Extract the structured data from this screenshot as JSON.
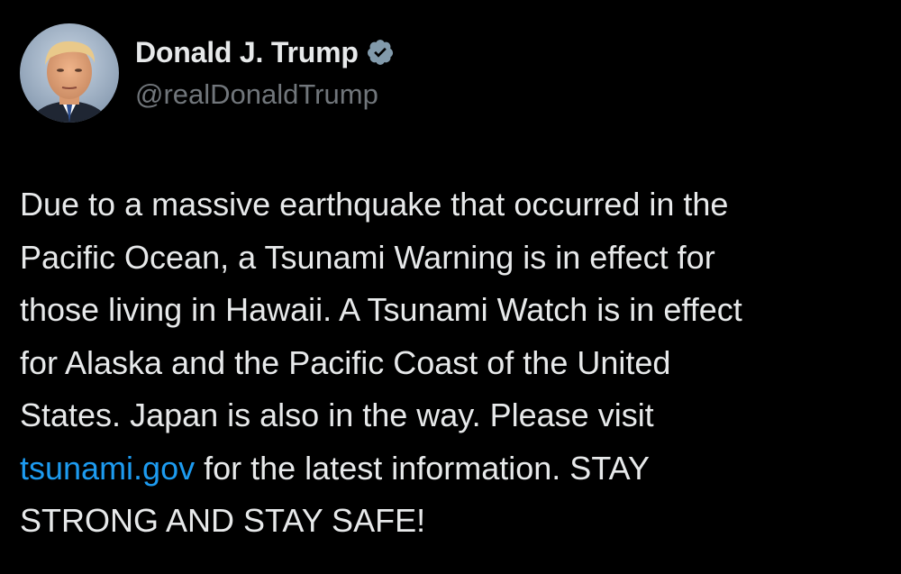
{
  "author": {
    "display_name": "Donald J. Trump",
    "handle": "@realDonaldTrump",
    "verified_icon": "verified-badge-icon",
    "avatar_icon": "profile-avatar"
  },
  "tweet": {
    "lines": [
      "Due to a massive earthquake that occurred in the",
      "Pacific Ocean, a Tsunami Warning is in effect for",
      "those living in Hawaii. A Tsunami Watch is in effect",
      "for Alaska and the Pacific Coast of the United",
      "States. Japan is also in the way. Please visit"
    ],
    "link_text": "tsunami.gov",
    "after_link": " for the latest information. STAY",
    "final_line": "STRONG AND STAY SAFE!"
  },
  "colors": {
    "background": "#000000",
    "primary_text": "#e7e9ea",
    "secondary_text": "#71767b",
    "link": "#1d9bf0"
  }
}
